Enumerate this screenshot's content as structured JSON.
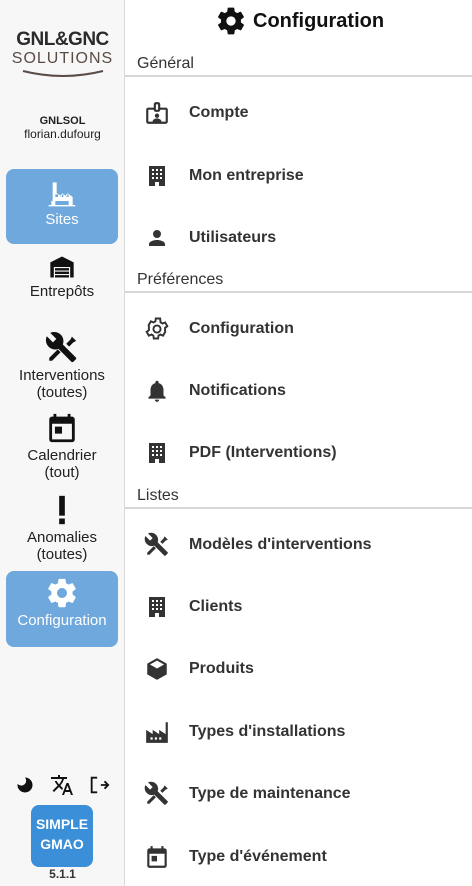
{
  "sidebar": {
    "logo": {
      "top": "GNL&GNC",
      "bottom": "SOLUTIONS"
    },
    "user": {
      "org": "GNLSOL",
      "name": "florian.dufourg"
    },
    "nav": [
      {
        "label": "Sites",
        "icon": "factory-icon",
        "active": true
      },
      {
        "label": "Entrepôts",
        "icon": "warehouse-icon",
        "active": false
      },
      {
        "label": "Interventions (toutes)",
        "line1": "Interventions",
        "line2": "(toutes)",
        "icon": "tools-icon",
        "active": false
      },
      {
        "label": "Calendrier (tout)",
        "line1": "Calendrier",
        "line2": "(tout)",
        "icon": "calendar-icon",
        "active": false
      },
      {
        "label": "Anomalies (toutes)",
        "line1": "Anomalies",
        "line2": "(toutes)",
        "icon": "exclamation-icon",
        "active": false
      },
      {
        "label": "Configuration",
        "icon": "gear-icon",
        "active": true
      }
    ],
    "footer": {
      "icons": [
        "moon-icon",
        "translate-icon",
        "logout-icon"
      ]
    },
    "app_badge": {
      "line1": "SIMPLE",
      "line2": "GMAO"
    },
    "version": "5.1.1"
  },
  "main": {
    "title": "Configuration",
    "sections": [
      {
        "label": "Général",
        "items": [
          {
            "label": "Compte",
            "icon": "badge-icon"
          },
          {
            "label": "Mon entreprise",
            "icon": "building-icon"
          },
          {
            "label": "Utilisateurs",
            "icon": "person-icon"
          }
        ]
      },
      {
        "label": "Préférences",
        "items": [
          {
            "label": "Configuration",
            "icon": "gear-outline-icon"
          },
          {
            "label": "Notifications",
            "icon": "bell-icon"
          },
          {
            "label": "PDF (Interventions)",
            "icon": "building-icon"
          }
        ]
      },
      {
        "label": "Listes",
        "items": [
          {
            "label": "Modèles d'interventions",
            "icon": "tools-icon"
          },
          {
            "label": "Clients",
            "icon": "building-icon"
          },
          {
            "label": "Produits",
            "icon": "cube-icon"
          },
          {
            "label": "Types d'installations",
            "icon": "factory-icon"
          },
          {
            "label": "Type de maintenance",
            "icon": "tools-icon"
          },
          {
            "label": "Type d'événement",
            "icon": "calendar-icon"
          }
        ]
      }
    ]
  },
  "colors": {
    "active_nav": "#6fa8dc",
    "app_badge": "#3a8fd8",
    "icon": "#333333"
  }
}
